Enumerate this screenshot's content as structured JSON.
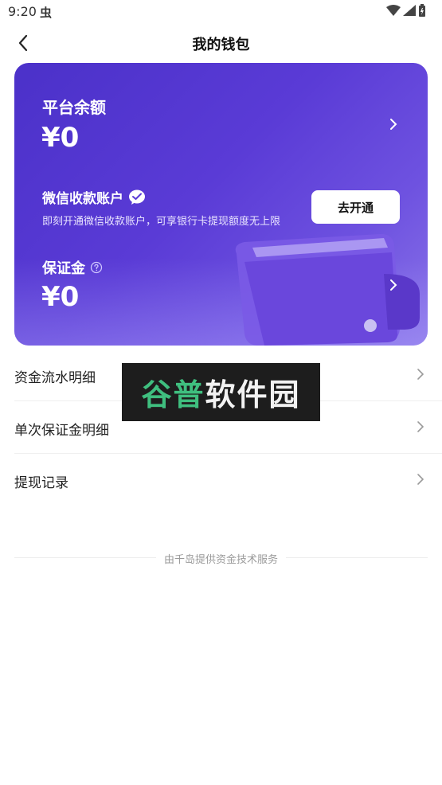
{
  "status_bar": {
    "time": "9:20",
    "notification_icon": "虫"
  },
  "nav": {
    "title": "我的钱包",
    "back_icon": "chevron-left-icon"
  },
  "card": {
    "balance_label": "平台余额",
    "balance_amount": "¥0",
    "wechat_title": "微信收款账户",
    "wechat_desc": "即刻开通微信收款账户，可享银行卡提现额度无上限",
    "open_button": "去开通",
    "deposit_label": "保证金",
    "deposit_amount": "¥0",
    "colors": {
      "gradient_start": "#4b31c9",
      "gradient_end": "#8a74e8"
    }
  },
  "menu": [
    {
      "label": "资金流水明细"
    },
    {
      "label": "单次保证金明细"
    },
    {
      "label": "提现记录"
    }
  ],
  "watermark": {
    "part1": "谷普",
    "part2": "软件园"
  },
  "footer": {
    "text": "由千岛提供资金技术服务"
  }
}
